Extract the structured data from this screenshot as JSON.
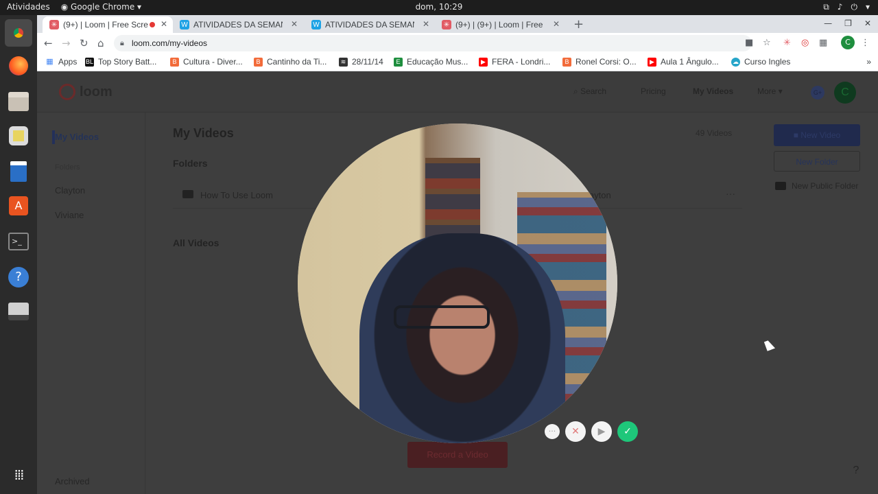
{
  "system": {
    "activities": "Atividades",
    "app_name": "Google Chrome",
    "clock": "dom, 10:29"
  },
  "tabs": [
    {
      "label": "(9+) | Loom | Free Scre",
      "favicon_color": "#e15b64"
    },
    {
      "label": "ATIVIDADES DA SEMANA",
      "favicon_color": "#1ea2e5"
    },
    {
      "label": "ATIVIDADES DA SEMANA",
      "favicon_color": "#1ea2e5"
    },
    {
      "label": "(9+) | (9+) | Loom | Free Sc",
      "favicon_color": "#e15b64"
    }
  ],
  "address": "loom.com/my-videos",
  "avatar_letter": "C",
  "bookmarks": [
    {
      "label": "Apps",
      "color": "#4285f4"
    },
    {
      "label": "Top Story Batt...",
      "color": "#111111",
      "icon_text": "BL"
    },
    {
      "label": "Cultura - Diver...",
      "color": "#f26b3a"
    },
    {
      "label": "Cantinho da Ti...",
      "color": "#f26b3a"
    },
    {
      "label": "28/11/14",
      "color": "#333333"
    },
    {
      "label": "Educação Mus...",
      "color": "#1e8e3e",
      "icon_text": "E"
    },
    {
      "label": "FERA - Londri...",
      "color": "#ff0000"
    },
    {
      "label": "Ronel Corsi: O...",
      "color": "#f26b3a"
    },
    {
      "label": "Aula 1 Ângulo...",
      "color": "#ff0000"
    },
    {
      "label": "Curso Ingles",
      "color": "#26a5c9"
    }
  ],
  "loom": {
    "brand": "loom",
    "nav": {
      "search": "Search",
      "pricing": "Pricing",
      "my_videos": "My Videos",
      "more": "More"
    },
    "gplus": "G+",
    "avatar": "C",
    "sidebar": {
      "my_videos": "My Videos",
      "folders_heading": "Folders",
      "folders": [
        "Clayton",
        "Viviane"
      ],
      "archived": "Archived"
    },
    "main": {
      "title": "My Videos",
      "video_count": "49 Videos",
      "folders_heading": "Folders",
      "folder_1": "How To Use Loom",
      "folder_2": "layton",
      "all_videos": "All Videos",
      "record_button": "Record a Video"
    },
    "actions": {
      "new_video": "New Video",
      "new_folder": "New Folder",
      "new_public_folder": "New Public Folder"
    },
    "help": "?"
  }
}
